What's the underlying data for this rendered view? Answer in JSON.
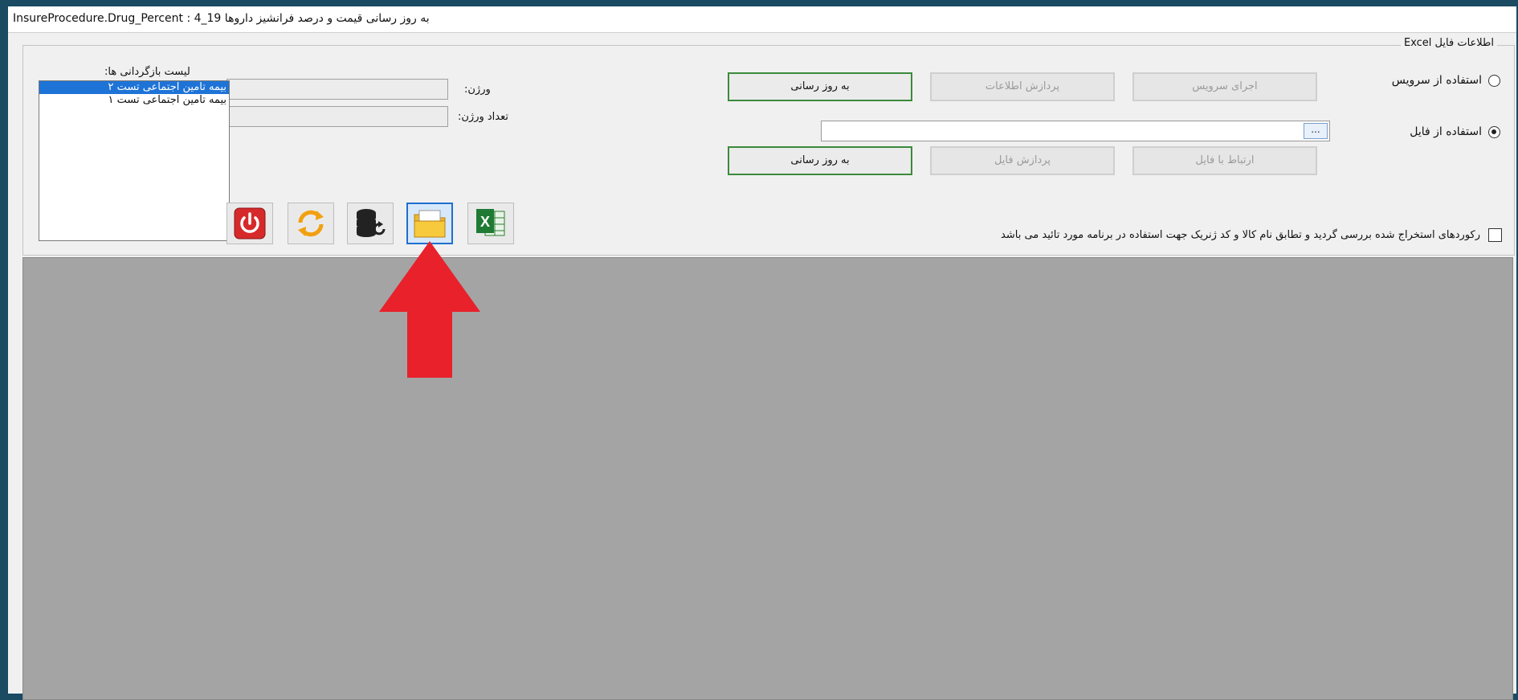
{
  "window": {
    "title": "InsureProcedure.Drug_Percent : 4_19 به روز رسانی قیمت و درصد فرانشیز داروها"
  },
  "excel_group": {
    "legend": "اطلاعات فایل Excel",
    "radio_service": {
      "label": "استفاده از سرویس",
      "checked": false
    },
    "radio_file": {
      "label": "استفاده از فایل",
      "checked": true
    },
    "service_buttons": {
      "run_service": "اجرای سرویس",
      "process_data": "پردازش اطلاعات",
      "update": "به روز رسانی"
    },
    "file_buttons": {
      "connect_file": "ارتباط با فایل",
      "process_file": "پردازش فایل",
      "update": "به روز رسانی"
    },
    "file_path": {
      "value": "",
      "browse_label": "..."
    },
    "confirm_checkbox": {
      "label": "رکوردهای استخراج شده بررسی گردید و تطابق نام کالا و کد ژنریک جهت استفاده در برنامه مورد تائید می باشد",
      "checked": false
    }
  },
  "version": {
    "label": "ورژن:",
    "value": ""
  },
  "version_count": {
    "label": "تعداد ورژن:",
    "value": ""
  },
  "restore_list": {
    "title": "لیست بازگردانی ها:",
    "items": [
      {
        "label": "بیمه تامین اجتماعی تست ۲",
        "selected": true
      },
      {
        "label": "بیمه تامین اجتماعی تست ۱",
        "selected": false
      }
    ]
  },
  "toolbar": {
    "buttons": [
      {
        "name": "power-icon",
        "focused": false
      },
      {
        "name": "refresh-icon",
        "focused": false
      },
      {
        "name": "database-restore-icon",
        "focused": false
      },
      {
        "name": "open-folder-icon",
        "focused": true
      },
      {
        "name": "excel-icon",
        "focused": false
      }
    ]
  },
  "colors": {
    "accent_green_border": "#3c8a3c",
    "selection_blue": "#1e73d7",
    "annotation_red": "#e8212b",
    "grid_gray": "#a4a4a4"
  }
}
